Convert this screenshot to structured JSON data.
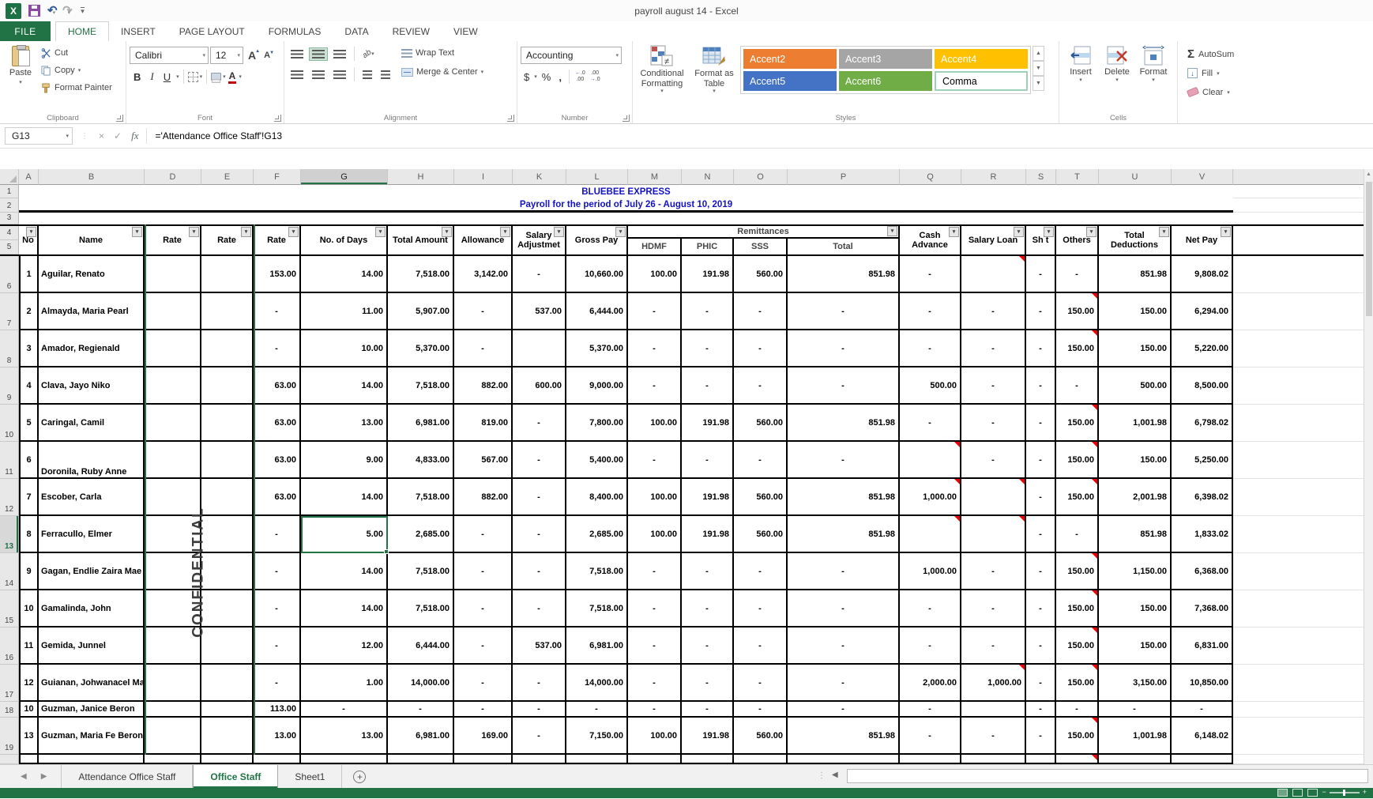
{
  "window": {
    "title": "payroll august 14 - Excel"
  },
  "ribbon_tabs": {
    "file": "FILE",
    "tabs": [
      "HOME",
      "INSERT",
      "PAGE LAYOUT",
      "FORMULAS",
      "DATA",
      "REVIEW",
      "VIEW"
    ],
    "active": "HOME"
  },
  "ribbon": {
    "clipboard": {
      "group": "Clipboard",
      "paste": "Paste",
      "cut": "Cut",
      "copy": "Copy",
      "format_painter": "Format Painter"
    },
    "font": {
      "group": "Font",
      "font_name": "Calibri",
      "font_size": "12"
    },
    "alignment": {
      "group": "Alignment",
      "wrap_text": "Wrap Text",
      "merge_center": "Merge & Center"
    },
    "number": {
      "group": "Number",
      "format": "Accounting"
    },
    "styles": {
      "group": "Styles",
      "conditional_formatting": "Conditional Formatting",
      "format_as_table": "Format as Table",
      "gallery": [
        {
          "label": "Accent2",
          "bg": "#ED7D31",
          "fg": "#FFFFFF",
          "selected": false
        },
        {
          "label": "Accent3",
          "bg": "#A5A5A5",
          "fg": "#FFFFFF",
          "selected": false
        },
        {
          "label": "Accent4",
          "bg": "#FFC000",
          "fg": "#FFFFFF",
          "selected": false
        },
        {
          "label": "Accent5",
          "bg": "#4472C4",
          "fg": "#FFFFFF",
          "selected": false
        },
        {
          "label": "Accent6",
          "bg": "#70AD47",
          "fg": "#FFFFFF",
          "selected": false
        },
        {
          "label": "Comma",
          "bg": "#FFFFFF",
          "fg": "#000000",
          "selected": true
        }
      ]
    },
    "cells": {
      "group": "Cells",
      "insert": "Insert",
      "delete": "Delete",
      "format": "Format"
    },
    "editing": {
      "autosum": "AutoSum",
      "fill": "Fill",
      "clear": "Clear"
    }
  },
  "formula_bar": {
    "name_box": "G13",
    "formula": "='Attendance Office Staff'!G13"
  },
  "sheet": {
    "column_letters": [
      "A",
      "B",
      "D",
      "E",
      "F",
      "G",
      "H",
      "I",
      "K",
      "L",
      "M",
      "N",
      "O",
      "P",
      "Q",
      "R",
      "S",
      "T",
      "U",
      "V"
    ],
    "selected_column": "G",
    "selected_row": 13,
    "selected_cell": "G13",
    "title1": "BLUEBEE EXPRESS",
    "title2": "Payroll for the period of July 26 - August  10, 2019",
    "watermark": "CONFIDENTIAL",
    "title_color": "#1212c4",
    "selection_color": "#217346",
    "flag_color": "#ff0000"
  },
  "table": {
    "headers": {
      "no": "No",
      "name": "Name",
      "rate": "Rate",
      "days": "No. of Days",
      "total_amount": "Total Amount",
      "allowance": "Allowance",
      "salary_adjustment": "Salary Adjustmet",
      "gross_pay": "Gross Pay",
      "remittances": "Remittances",
      "hdmf": "HDMF",
      "phic": "PHIC",
      "sss": "SSS",
      "remit_total": "Total",
      "cash_advance": "Cash Advance",
      "salary_loan": "Salary Loan",
      "shirt": "Sh t",
      "others": "Others",
      "total_deductions": "Total Deductions",
      "net_pay": "Net Pay"
    },
    "rows": [
      {
        "row": 6,
        "no": "1",
        "name": "Aguilar, Renato",
        "rate_d": "",
        "rate_e": "",
        "rate_f": "153.00",
        "days": "14.00",
        "total_amount": "7,518.00",
        "allowance": "3,142.00",
        "salary_adj": "-",
        "gross_pay": "10,660.00",
        "hdmf": "100.00",
        "phic": "191.98",
        "sss": "560.00",
        "remit_total": "851.98",
        "cash_advance": "-",
        "salary_loan": "",
        "sh": "-",
        "others": "-",
        "total_deductions": "851.98",
        "net_pay": "9,808.02",
        "flags": [
          "R"
        ]
      },
      {
        "row": 7,
        "no": "2",
        "name": "Almayda, Maria Pearl",
        "rate_d": "",
        "rate_e": "",
        "rate_f": "-",
        "days": "11.00",
        "total_amount": "5,907.00",
        "allowance": "-",
        "salary_adj": "537.00",
        "gross_pay": "6,444.00",
        "hdmf": "-",
        "phic": "-",
        "sss": "-",
        "remit_total": "-",
        "cash_advance": "-",
        "salary_loan": "-",
        "sh": "-",
        "others": "150.00",
        "total_deductions": "150.00",
        "net_pay": "6,294.00",
        "flags": [
          "T"
        ]
      },
      {
        "row": 8,
        "no": "3",
        "name": "Amador, Regienald",
        "rate_d": "",
        "rate_e": "",
        "rate_f": "-",
        "days": "10.00",
        "total_amount": "5,370.00",
        "allowance": "-",
        "salary_adj": "",
        "gross_pay": "5,370.00",
        "hdmf": "-",
        "phic": "-",
        "sss": "-",
        "remit_total": "-",
        "cash_advance": "-",
        "salary_loan": "-",
        "sh": "-",
        "others": "150.00",
        "total_deductions": "150.00",
        "net_pay": "5,220.00",
        "flags": [
          "T"
        ]
      },
      {
        "row": 9,
        "no": "4",
        "name": "Clava, Jayo Niko",
        "rate_d": "",
        "rate_e": "",
        "rate_f": "63.00",
        "days": "14.00",
        "total_amount": "7,518.00",
        "allowance": "882.00",
        "salary_adj": "600.00",
        "gross_pay": "9,000.00",
        "hdmf": "-",
        "phic": "-",
        "sss": "-",
        "remit_total": "-",
        "cash_advance": "500.00",
        "salary_loan": "-",
        "sh": "-",
        "others": "-",
        "total_deductions": "500.00",
        "net_pay": "8,500.00",
        "flags": []
      },
      {
        "row": 10,
        "no": "5",
        "name": "Caringal, Camil",
        "rate_d": "",
        "rate_e": "",
        "rate_f": "63.00",
        "days": "13.00",
        "total_amount": "6,981.00",
        "allowance": "819.00",
        "salary_adj": "-",
        "gross_pay": "7,800.00",
        "hdmf": "100.00",
        "phic": "191.98",
        "sss": "560.00",
        "remit_total": "851.98",
        "cash_advance": "-",
        "salary_loan": "-",
        "sh": "-",
        "others": "150.00",
        "total_deductions": "1,001.98",
        "net_pay": "6,798.02",
        "flags": [
          "T"
        ]
      },
      {
        "row": 11,
        "no": "6",
        "name": "Doronila, Ruby Anne",
        "name_bottom": true,
        "rate_d": "",
        "rate_e": "",
        "rate_f": "63.00",
        "days": "9.00",
        "total_amount": "4,833.00",
        "allowance": "567.00",
        "salary_adj": "-",
        "gross_pay": "5,400.00",
        "hdmf": "-",
        "phic": "-",
        "sss": "-",
        "remit_total": "-",
        "cash_advance": "",
        "salary_loan": "-",
        "sh": "-",
        "others": "150.00",
        "total_deductions": "150.00",
        "net_pay": "5,250.00",
        "flags": [
          "Q",
          "T"
        ]
      },
      {
        "row": 12,
        "no": "7",
        "name": "Escober, Carla",
        "rate_d": "",
        "rate_e": "",
        "rate_f": "63.00",
        "days": "14.00",
        "total_amount": "7,518.00",
        "allowance": "882.00",
        "salary_adj": "-",
        "gross_pay": "8,400.00",
        "hdmf": "100.00",
        "phic": "191.98",
        "sss": "560.00",
        "remit_total": "851.98",
        "cash_advance": "1,000.00",
        "salary_loan": "",
        "sh": "-",
        "others": "150.00",
        "total_deductions": "2,001.98",
        "net_pay": "6,398.02",
        "flags": [
          "Q",
          "R",
          "T"
        ]
      },
      {
        "row": 13,
        "no": "8",
        "name": "Ferracullo, Elmer",
        "selected": true,
        "rate_d": "",
        "rate_e": "",
        "rate_f": "-",
        "days": "5.00",
        "total_amount": "2,685.00",
        "allowance": "-",
        "salary_adj": "-",
        "gross_pay": "2,685.00",
        "hdmf": "100.00",
        "phic": "191.98",
        "sss": "560.00",
        "remit_total": "851.98",
        "cash_advance": "",
        "salary_loan": "",
        "sh": "-",
        "others": "-",
        "total_deductions": "851.98",
        "net_pay": "1,833.02",
        "flags": [
          "Q",
          "R"
        ]
      },
      {
        "row": 14,
        "no": "9",
        "name": "Gagan, Endlie Zaira Mae",
        "rate_d": "",
        "rate_e": "",
        "rate_f": "-",
        "days": "14.00",
        "total_amount": "7,518.00",
        "allowance": "-",
        "salary_adj": "-",
        "gross_pay": "7,518.00",
        "hdmf": "-",
        "phic": "-",
        "sss": "-",
        "remit_total": "-",
        "cash_advance": "1,000.00",
        "salary_loan": "-",
        "sh": "-",
        "others": "150.00",
        "total_deductions": "1,150.00",
        "net_pay": "6,368.00",
        "flags": [
          "T"
        ]
      },
      {
        "row": 15,
        "no": "10",
        "name": "Gamalinda, John",
        "rate_d": "",
        "rate_e": "",
        "rate_f": "-",
        "days": "14.00",
        "total_amount": "7,518.00",
        "allowance": "-",
        "salary_adj": "-",
        "gross_pay": "7,518.00",
        "hdmf": "-",
        "phic": "-",
        "sss": "-",
        "remit_total": "-",
        "cash_advance": "-",
        "salary_loan": "-",
        "sh": "-",
        "others": "150.00",
        "total_deductions": "150.00",
        "net_pay": "7,368.00",
        "flags": [
          "T"
        ]
      },
      {
        "row": 16,
        "no": "11",
        "name": "Gemida, Junnel",
        "rate_d": "",
        "rate_e": "",
        "rate_f": "-",
        "days": "12.00",
        "total_amount": "6,444.00",
        "allowance": "-",
        "salary_adj": "537.00",
        "gross_pay": "6,981.00",
        "hdmf": "-",
        "phic": "-",
        "sss": "-",
        "remit_total": "-",
        "cash_advance": "-",
        "salary_loan": "-",
        "sh": "-",
        "others": "150.00",
        "total_deductions": "150.00",
        "net_pay": "6,831.00",
        "flags": [
          "T"
        ]
      },
      {
        "row": 17,
        "no": "12",
        "name": "Guianan, Johwanacel Ma",
        "rate_d": "",
        "rate_e": "",
        "rate_f": "-",
        "days": "1.00",
        "total_amount": "14,000.00",
        "allowance": "-",
        "salary_adj": "-",
        "gross_pay": "14,000.00",
        "hdmf": "-",
        "phic": "-",
        "sss": "-",
        "remit_total": "-",
        "cash_advance": "2,000.00",
        "salary_loan": "1,000.00",
        "sh": "-",
        "others": "150.00",
        "total_deductions": "3,150.00",
        "net_pay": "10,850.00",
        "flags": [
          "R",
          "T"
        ]
      },
      {
        "row": 18,
        "no": "10",
        "name": "Guzman, Janice Beron",
        "compact": true,
        "rate_d": "",
        "rate_e": "",
        "rate_f": "113.00",
        "days": "-",
        "total_amount": "-",
        "allowance": "-",
        "salary_adj": "-",
        "gross_pay": "-",
        "hdmf": "-",
        "phic": "-",
        "sss": "-",
        "remit_total": "-",
        "cash_advance": "-",
        "salary_loan": "",
        "sh": "-",
        "others": "-",
        "total_deductions": "-",
        "net_pay": "-",
        "flags": []
      },
      {
        "row": 19,
        "no": "13",
        "name": "Guzman, Maria Fe Beron",
        "rate_d": "",
        "rate_e": "",
        "rate_f": "13.00",
        "days": "13.00",
        "total_amount": "6,981.00",
        "allowance": "169.00",
        "salary_adj": "-",
        "gross_pay": "7,150.00",
        "hdmf": "100.00",
        "phic": "191.98",
        "sss": "560.00",
        "remit_total": "851.98",
        "cash_advance": "-",
        "salary_loan": "-",
        "sh": "-",
        "others": "150.00",
        "total_deductions": "1,001.98",
        "net_pay": "6,148.02",
        "flags": [
          "T"
        ]
      }
    ]
  },
  "sheet_tabs": {
    "tabs": [
      "Attendance Office Staff",
      "Office Staff",
      "Sheet1"
    ],
    "active": "Office Staff"
  },
  "status_bar": {
    "views": [
      "normal-view",
      "page-layout-view",
      "page-break-view"
    ]
  }
}
